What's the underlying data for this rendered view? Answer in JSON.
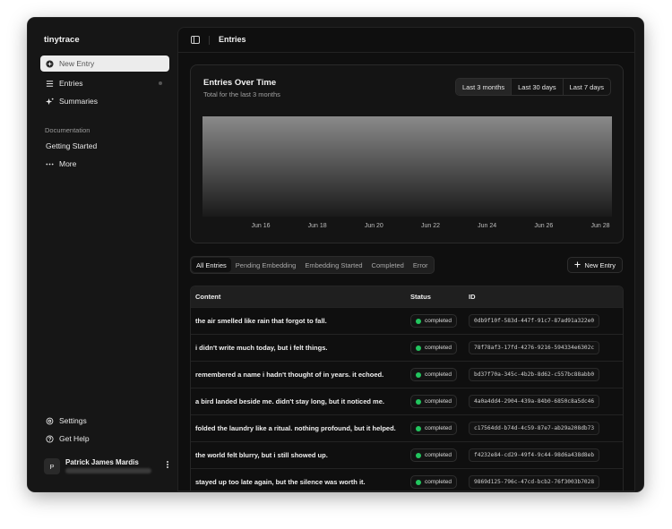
{
  "app": {
    "name": "tinytrace"
  },
  "sidebar": {
    "new_entry": "New Entry",
    "items": [
      {
        "label": "Entries",
        "icon": "list-icon"
      },
      {
        "label": "Summaries",
        "icon": "sparkles-icon"
      }
    ],
    "documentation_label": "Documentation",
    "doc_items": [
      {
        "label": "Getting Started"
      },
      {
        "label": "More",
        "icon": "ellipsis-icon"
      }
    ],
    "footer_items": [
      {
        "label": "Settings",
        "icon": "gear-icon"
      },
      {
        "label": "Get Help",
        "icon": "help-icon"
      }
    ],
    "user": {
      "initial": "P",
      "name": "Patrick James Mardis"
    }
  },
  "header": {
    "title": "Entries"
  },
  "chart_card": {
    "title": "Entries Over Time",
    "subtitle": "Total for the last 3 months",
    "ranges": [
      "Last 3 months",
      "Last 30 days",
      "Last 7 days"
    ],
    "selected_range": "Last 3 months"
  },
  "chart_data": {
    "type": "area",
    "x": [
      "Jun 16",
      "Jun 18",
      "Jun 20",
      "Jun 22",
      "Jun 24",
      "Jun 26",
      "Jun 28"
    ],
    "tick_labels": [
      "Jun 16",
      "Jun 18",
      "Jun 20",
      "Jun 22",
      "Jun 24",
      "Jun 26",
      "Jun 28"
    ],
    "grid": false,
    "colors": {
      "top": "#8a8a8a",
      "bottom": "#1a1a1a"
    }
  },
  "filters": {
    "tabs": [
      "All Entries",
      "Pending Embedding",
      "Embedding Started",
      "Completed",
      "Error"
    ],
    "active": "All Entries",
    "new_entry_label": "New Entry"
  },
  "table": {
    "headers": {
      "content": "Content",
      "status": "Status",
      "id": "ID"
    },
    "rows": [
      {
        "content": "the air smelled like rain that forgot to fall.",
        "status": "completed",
        "id": "0db9f10f-583d-447f-91c7-87ad91a322e0"
      },
      {
        "content": "i didn't write much today, but i felt things.",
        "status": "completed",
        "id": "78f78af3-17fd-4276-9216-594334e6302c"
      },
      {
        "content": "remembered a name i hadn't thought of in years. it echoed.",
        "status": "completed",
        "id": "bd37f70a-345c-4b2b-8d62-c557bc88abb0"
      },
      {
        "content": "a bird landed beside me. didn't stay long, but it noticed me.",
        "status": "completed",
        "id": "4a0a4dd4-2904-439a-84b0-6850c8a5dc46"
      },
      {
        "content": "folded the laundry like a ritual. nothing profound, but it helped.",
        "status": "completed",
        "id": "c17564dd-b74d-4c59-87e7-ab29a208db73"
      },
      {
        "content": "the world felt blurry, but i still showed up.",
        "status": "completed",
        "id": "f4232e84-cd29-49f4-9c44-98d6a438d8eb"
      },
      {
        "content": "stayed up too late again, but the silence was worth it.",
        "status": "completed",
        "id": "9869d125-796c-47cd-bcb2-76f3003b7028"
      }
    ]
  },
  "colors": {
    "status_completed": "#22c55e",
    "background": "#0f0f0f",
    "sidebar": "#161616"
  }
}
